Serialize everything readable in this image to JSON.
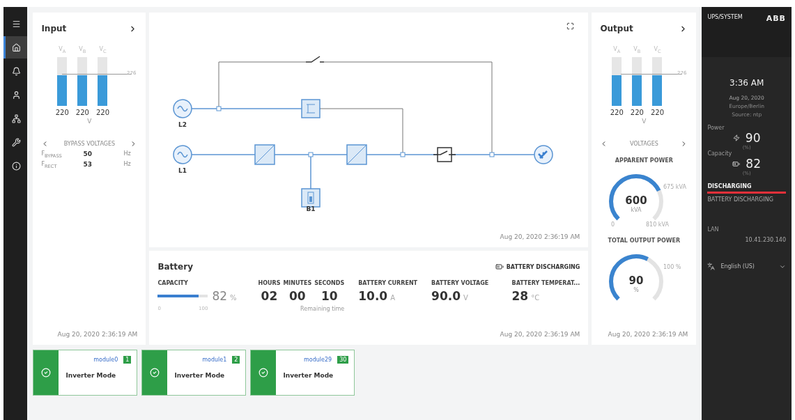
{
  "sidebar": {
    "items": [
      {
        "selected": false
      },
      {
        "selected": true
      },
      {
        "selected": false
      },
      {
        "selected": false
      },
      {
        "selected": false
      },
      {
        "selected": false
      },
      {
        "selected": false
      }
    ]
  },
  "input": {
    "title": "Input",
    "threshold": "276",
    "unit": "V",
    "bars": [
      {
        "label": "V$_{A}$",
        "value": "220",
        "level": 0.62
      },
      {
        "label": "V$_{B}$",
        "value": "220",
        "level": 0.62
      },
      {
        "label": "V$_{C}$",
        "value": "220",
        "level": 0.62
      }
    ],
    "pager": "BYPASS VOLTAGES",
    "readings": [
      {
        "label": "F$_{BYPASS}$",
        "value": "50",
        "unit": "Hz"
      },
      {
        "label": "F$_{RECT}$",
        "value": "53",
        "unit": "Hz"
      }
    ],
    "timestamp": "Aug 20, 2020 2:36:19 AM"
  },
  "diagram": {
    "sources": [
      "L2",
      "L1"
    ],
    "battery": "B1",
    "timestamp": "Aug 20, 2020 2:36:19 AM"
  },
  "battery": {
    "title": "Battery",
    "status": "BATTERY DISCHARGING",
    "capacity": {
      "label": "CAPACITY",
      "level": 0.82,
      "value": "82",
      "unit": "%",
      "min": "0",
      "max": "100"
    },
    "time": [
      {
        "label": "HOURS",
        "value": "02"
      },
      {
        "label": "MINUTES",
        "value": "00"
      },
      {
        "label": "SECONDS",
        "value": "10"
      }
    ],
    "time_caption": "Remaining time",
    "metrics": [
      {
        "label": "BATTERY CURRENT",
        "value": "10.0",
        "unit": "A"
      },
      {
        "label": "BATTERY VOLTAGE",
        "value": "90.0",
        "unit": "V"
      },
      {
        "label": "BATTERY TEMPERAT...",
        "value": "28",
        "unit": "°C"
      }
    ],
    "timestamp": "Aug 20, 2020 2:36:19 AM"
  },
  "output": {
    "title": "Output",
    "threshold": "276",
    "unit": "V",
    "bars": [
      {
        "label": "V$_{A}$",
        "value": "220",
        "level": 0.62
      },
      {
        "label": "V$_{B}$",
        "value": "220",
        "level": 0.62
      },
      {
        "label": "V$_{C}$",
        "value": "220",
        "level": 0.62
      }
    ],
    "pager": "VOLTAGES",
    "gauges": [
      {
        "title": "APPARENT POWER",
        "value": "600",
        "unit": "kVA",
        "limit": "675 kVA",
        "min": "0",
        "max": "810 kVA"
      },
      {
        "title": "TOTAL OUTPUT POWER",
        "value": "90",
        "unit": "%",
        "limit": "100 %"
      }
    ],
    "timestamp": "Aug 20, 2020 2:36:19 AM"
  },
  "modules": [
    {
      "name": "module0",
      "number": "1",
      "mode": "Inverter Mode",
      "color": "#2e9e48"
    },
    {
      "name": "module1",
      "number": "2",
      "mode": "Inverter Mode",
      "color": "#2e9e48"
    },
    {
      "name": "module29",
      "number": "30",
      "mode": "Inverter Mode",
      "color": "#2e9e48"
    }
  ],
  "system": {
    "title": "UPS/SYSTEM",
    "logo": "ABB",
    "time": "3:36 AM",
    "date": "Aug 20, 2020",
    "timezone": "Europe/Berlin",
    "source": "Source: ntp",
    "power": {
      "label": "Power",
      "value": "90",
      "unit": "(%)"
    },
    "capacity": {
      "label": "Capacity",
      "value": "82",
      "unit": "(%)"
    },
    "state": "DISCHARGING",
    "state_detail": "BATTERY DISCHARGING",
    "network": {
      "label": "LAN",
      "address": "10.41.230.140"
    },
    "language": "English (US)"
  }
}
